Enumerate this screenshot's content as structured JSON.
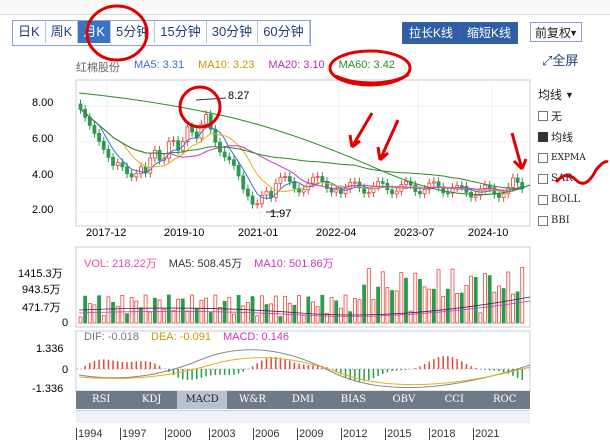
{
  "toolbar": {
    "periods": [
      {
        "label": "日K",
        "active": false
      },
      {
        "label": "周K",
        "active": false
      },
      {
        "label": "月K",
        "active": true
      },
      {
        "label": "5分钟",
        "active": false
      },
      {
        "label": "15分钟",
        "active": false
      },
      {
        "label": "30分钟",
        "active": false
      },
      {
        "label": "60分钟",
        "active": false
      }
    ],
    "zoom_in": "拉长K线",
    "zoom_out": "缩短K线",
    "fq": "前复权",
    "fullscreen": "全屏"
  },
  "ma": {
    "stock": "红棉股份",
    "ma5": "MA5: 3.31",
    "ma10": "MA10: 3.23",
    "ma20": "MA20: 3.10",
    "ma60": "MA60: 3.42"
  },
  "price": {
    "yticks": [
      "8.00",
      "6.00",
      "4.00",
      "2.00"
    ],
    "high_label": "8.27",
    "low_label": "1.97",
    "xticks": [
      "2017-12",
      "2019-10",
      "2021-01",
      "2022-04",
      "2023-07",
      "2024-10"
    ]
  },
  "volume": {
    "vol": "VOL: 218.22万",
    "ma5": "MA5: 508.45万",
    "ma10": "MA10: 501.86万",
    "yticks": [
      "1415.3万",
      "943.5万",
      "471.7万",
      "0"
    ]
  },
  "macd": {
    "dif": "DIF: -0.018",
    "dea": "DEA: -0.091",
    "macd": "MACD: 0.146",
    "yticks": [
      "1.336",
      "0",
      "-1.336"
    ]
  },
  "indicators": {
    "title": "均线",
    "items": [
      {
        "label": "无",
        "checked": false
      },
      {
        "label": "均线",
        "checked": true
      },
      {
        "label": "EXPMA",
        "checked": false
      },
      {
        "label": "SAR",
        "checked": false
      },
      {
        "label": "BOLL",
        "checked": false
      },
      {
        "label": "BBI",
        "checked": false
      }
    ]
  },
  "tabs": [
    {
      "label": "RSI",
      "active": false
    },
    {
      "label": "KDJ",
      "active": false
    },
    {
      "label": "MACD",
      "active": true
    },
    {
      "label": "W&R",
      "active": false
    },
    {
      "label": "DMI",
      "active": false
    },
    {
      "label": "BIAS",
      "active": false
    },
    {
      "label": "OBV",
      "active": false
    },
    {
      "label": "CCI",
      "active": false
    },
    {
      "label": "ROC",
      "active": false
    }
  ],
  "timeline": [
    "1994",
    "1997",
    "2000",
    "2003",
    "2006",
    "2009",
    "2012",
    "2015",
    "2018",
    "2021"
  ],
  "colors": {
    "up": "#e8453c",
    "down": "#2a9a4e",
    "ma5": "#3a6fd0",
    "ma10": "#e0b020",
    "ma20": "#d032c8",
    "ma60": "#2a8a2a",
    "annotation": "#e00000"
  }
}
